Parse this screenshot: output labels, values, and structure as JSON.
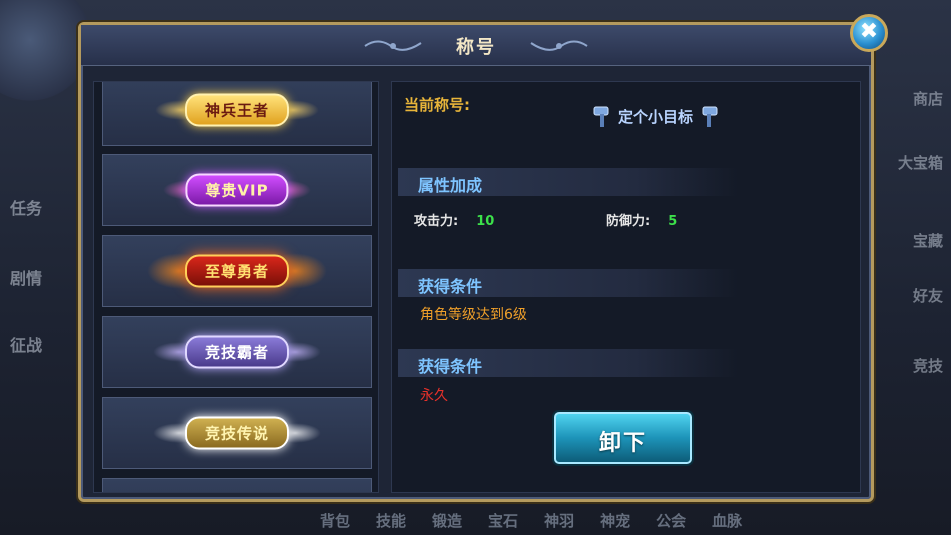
{
  "dialog": {
    "title": "称号",
    "close_icon": "close-icon"
  },
  "title_list": [
    {
      "label": "神兵王者",
      "style": "gold"
    },
    {
      "label": "尊贵VIP",
      "style": "purple"
    },
    {
      "label": "至尊勇者",
      "style": "fire"
    },
    {
      "label": "竞技霸者",
      "style": "violet"
    },
    {
      "label": "竞技传说",
      "style": "white-gold"
    }
  ],
  "detail": {
    "current_label": "当前称号:",
    "current_title": "定个小目标",
    "attr_header": "属性加成",
    "attack_label": "攻击力:",
    "attack_value": "10",
    "defense_label": "防御力:",
    "defense_value": "5",
    "cond_header_1": "获得条件",
    "cond_text_1": "角色等级达到6级",
    "cond_header_2": "获得条件",
    "cond_text_2": "永久",
    "unequip_button": "卸下"
  },
  "background": {
    "left_menu": [
      "任务",
      "剧情",
      "征战"
    ],
    "right_menu": [
      "商店",
      "大宝箱",
      "宝藏",
      "好友",
      "竞技"
    ],
    "bottom_menu": [
      "背包",
      "技能",
      "锻造",
      "宝石",
      "神羽",
      "神宠",
      "公会",
      "血脉"
    ]
  },
  "colors": {
    "frame_gold": "#b49a5e",
    "accent_blue": "#7ec4ff",
    "label_gold": "#e8b53a",
    "value_green": "#3ce04a",
    "warn_red": "#e8312a"
  }
}
